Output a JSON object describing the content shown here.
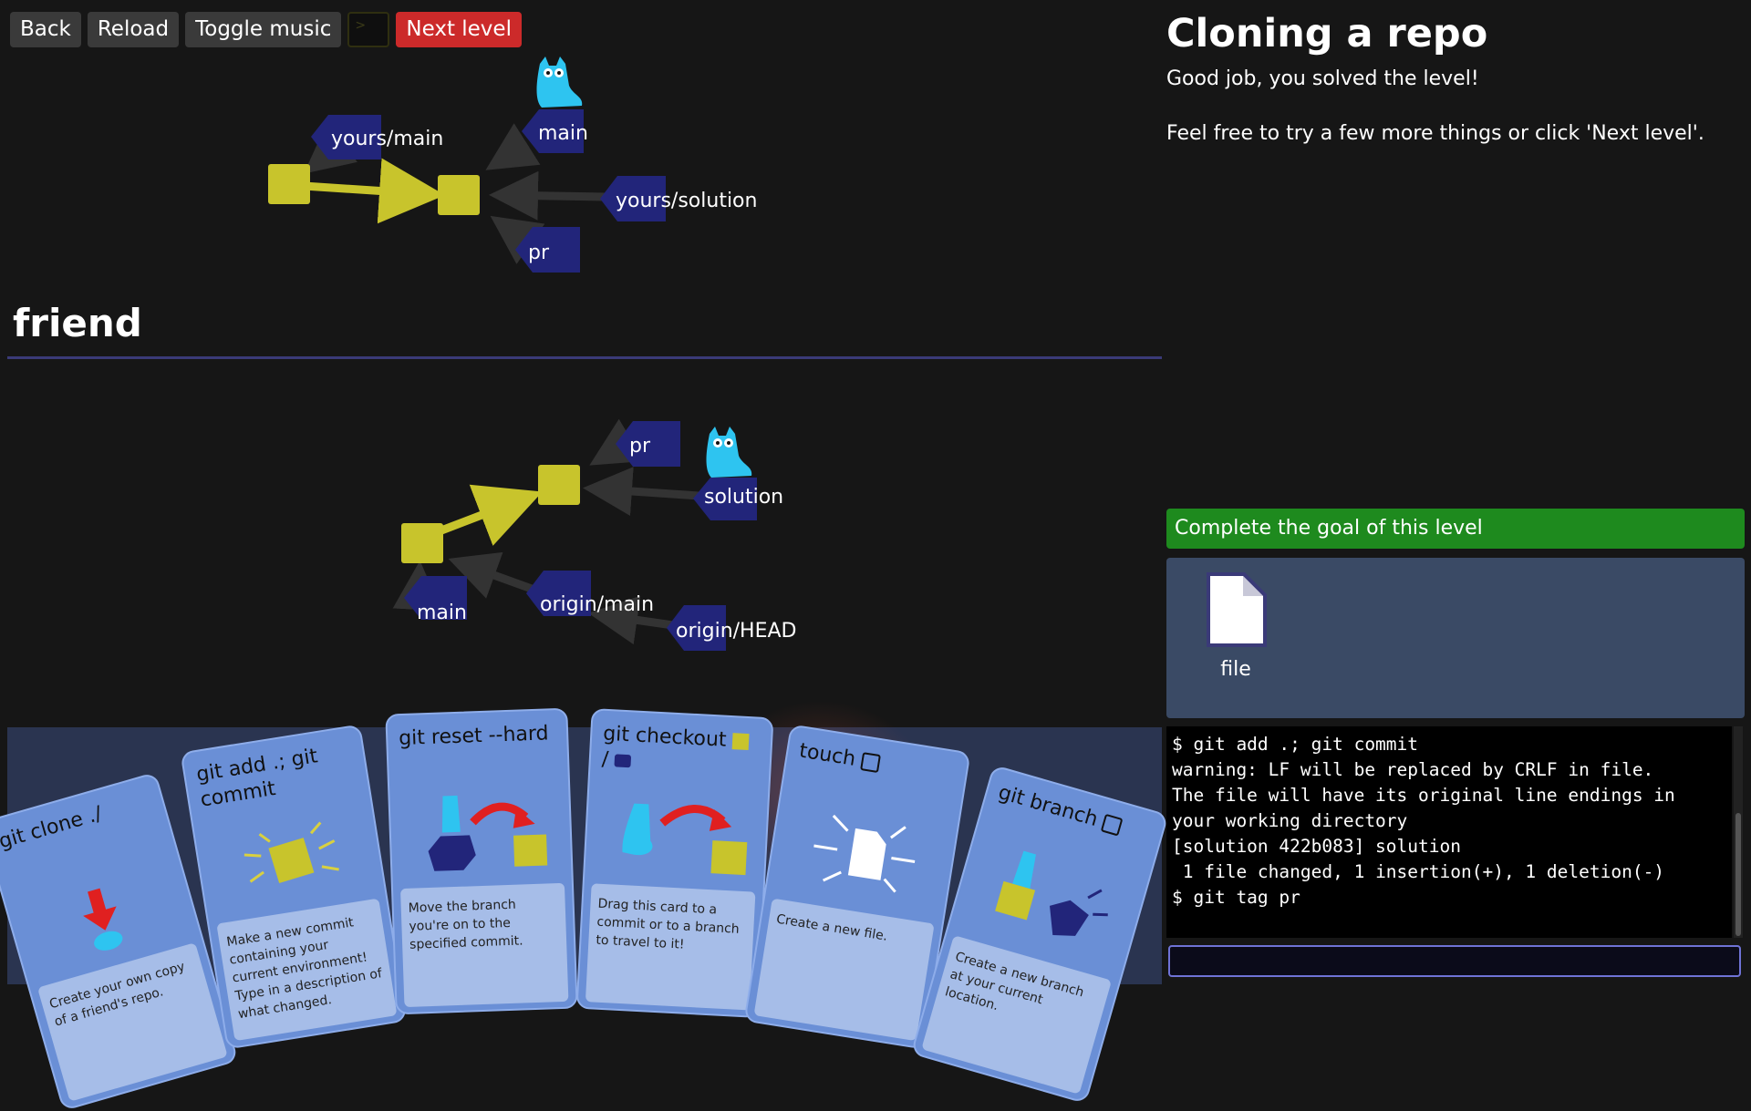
{
  "toolbar": {
    "back": "Back",
    "reload": "Reload",
    "toggle_music": "Toggle music",
    "terminal_glyph": ">",
    "next_level": "Next level"
  },
  "yours_graph": {
    "refs": {
      "yours_main": "yours/main",
      "main": "main",
      "yours_solution": "yours/solution",
      "pr": "pr"
    }
  },
  "friend": {
    "title": "friend",
    "refs": {
      "pr": "pr",
      "solution": "solution",
      "main": "main",
      "origin_main": "origin/main",
      "origin_head": "origin/HEAD"
    }
  },
  "level": {
    "title": "Cloning a repo",
    "desc1": "Good job, you solved the level!",
    "desc2": "Feel free to try a few more things or click 'Next level'."
  },
  "goal": "Complete the goal of this level",
  "files": [
    {
      "name": "file"
    }
  ],
  "terminal": {
    "lines": [
      "$ git add .; git commit",
      "warning: LF will be replaced by CRLF in file.",
      "The file will have its original line endings in your working directory",
      "[solution 422b083] solution",
      " 1 file changed, 1 insertion(+), 1 deletion(-)",
      "$ git tag pr"
    ],
    "input_value": ""
  },
  "cards": [
    {
      "title": "git clone ./",
      "desc": "Create your own copy of a friend's repo."
    },
    {
      "title": "git add .; git commit",
      "desc": "Make a new commit containing your current environment! Type in a description of what changed."
    },
    {
      "title": "git reset --hard",
      "desc": "Move the branch you're on to the specified commit."
    },
    {
      "title": "git checkout",
      "title_suffix": "/",
      "desc": "Drag this card to a commit or to a branch to travel to it!"
    },
    {
      "title": "touch",
      "desc": "Create a new file."
    },
    {
      "title": "git branch",
      "desc": "Create a new branch at your current location."
    }
  ],
  "colors": {
    "background": "#161616",
    "commit": "#c8c42c",
    "ref": "#22257a",
    "goal": "#1e8a1e",
    "next_level": "#cc2a2a",
    "card": "#6a8fd6",
    "head_mascot": "#2ec4f0"
  }
}
